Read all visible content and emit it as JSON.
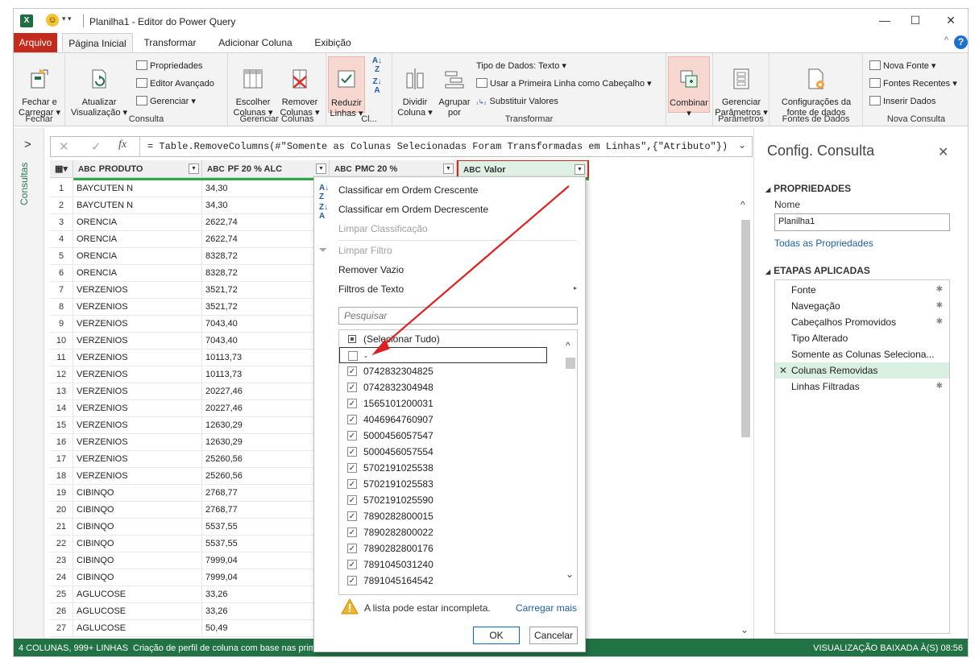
{
  "window": {
    "title": "Planilha1 - Editor do Power Query",
    "app_icon": "X",
    "quick_access": "▾ ▾"
  },
  "tabs": [
    "Arquivo",
    "Página Inicial",
    "Transformar",
    "Adicionar Coluna",
    "Exibição"
  ],
  "ribbon": {
    "fechar": {
      "btn": "Fechar e\nCarregar ▾",
      "group": "Fechar"
    },
    "consulta": {
      "atualizar": "Atualizar\nVisualização ▾",
      "propriedades": "Propriedades",
      "editor_avancado": "Editor Avançado",
      "gerenciar": "Gerenciar ▾",
      "group": "Consulta"
    },
    "colunas": {
      "escolher": "Escolher\nColunas ▾",
      "remover": "Remover\nColunas ▾",
      "group": "Gerenciar Colunas"
    },
    "reduzir": {
      "btn": "Reduzir\nLinhas ▾",
      "group": "Cl..."
    },
    "transformar": {
      "dividir": "Dividir\nColuna ▾",
      "agrupar": "Agrupar\npor",
      "tipo": "Tipo de Dados: Texto ▾",
      "primeira_linha": "Usar a Primeira Linha como Cabeçalho ▾",
      "substituir": "Substituir Valores",
      "group": "Transformar"
    },
    "combinar": {
      "btn": "Combinar\n▾"
    },
    "parametros": {
      "btn": "Gerenciar\nParâmetros ▾",
      "group": "Parâmetros"
    },
    "fontes": {
      "btn": "Configurações da\nfonte de dados",
      "group": "Fontes de Dados"
    },
    "nova": {
      "nova_fonte": "Nova Fonte ▾",
      "recentes": "Fontes Recentes ▾",
      "inserir": "Inserir Dados",
      "group": "Nova Consulta"
    }
  },
  "left_nav": {
    "label": "Consultas"
  },
  "formula": "= Table.RemoveColumns(#\"Somente as Colunas Selecionadas Foram Transformadas em Linhas\",{\"Atributo\"})",
  "columns": [
    {
      "type": "ABC",
      "name": "PRODUTO"
    },
    {
      "type": "ABC",
      "name": "PF 20 % ALC"
    },
    {
      "type": "ABC",
      "name": "PMC 20 %"
    },
    {
      "type": "ABC",
      "name": "Valor"
    }
  ],
  "rows": [
    [
      "1",
      "BAYCUTEN N",
      "34,30"
    ],
    [
      "2",
      "BAYCUTEN N",
      "34,30"
    ],
    [
      "3",
      "ORENCIA",
      "2622,74"
    ],
    [
      "4",
      "ORENCIA",
      "2622,74"
    ],
    [
      "5",
      "ORENCIA",
      "8328,72"
    ],
    [
      "6",
      "ORENCIA",
      "8328,72"
    ],
    [
      "7",
      "VERZENIOS",
      "3521,72"
    ],
    [
      "8",
      "VERZENIOS",
      "3521,72"
    ],
    [
      "9",
      "VERZENIOS",
      "7043,40"
    ],
    [
      "10",
      "VERZENIOS",
      "7043,40"
    ],
    [
      "11",
      "VERZENIOS",
      "10113,73"
    ],
    [
      "12",
      "VERZENIOS",
      "10113,73"
    ],
    [
      "13",
      "VERZENIOS",
      "20227,46"
    ],
    [
      "14",
      "VERZENIOS",
      "20227,46"
    ],
    [
      "15",
      "VERZENIOS",
      "12630,29"
    ],
    [
      "16",
      "VERZENIOS",
      "12630,29"
    ],
    [
      "17",
      "VERZENIOS",
      "25260,56"
    ],
    [
      "18",
      "VERZENIOS",
      "25260,56"
    ],
    [
      "19",
      "CIBINQO",
      "2768,77"
    ],
    [
      "20",
      "CIBINQO",
      "2768,77"
    ],
    [
      "21",
      "CIBINQO",
      "5537,55"
    ],
    [
      "22",
      "CIBINQO",
      "5537,55"
    ],
    [
      "23",
      "CIBINQO",
      "7999,04"
    ],
    [
      "24",
      "CIBINQO",
      "7999,04"
    ],
    [
      "25",
      "AGLUCOSE",
      "33,26"
    ],
    [
      "26",
      "AGLUCOSE",
      "33,26"
    ],
    [
      "27",
      "AGLUCOSE",
      "50,49"
    ]
  ],
  "popup": {
    "sort_asc": "Classificar em Ordem Crescente",
    "sort_desc": "Classificar em Ordem Decrescente",
    "clear_sort": "Limpar Classificação",
    "clear_filter": "Limpar Filtro",
    "remove_empty": "Remover Vazio",
    "text_filters": "Filtros de Texto",
    "search_placeholder": "Pesquisar",
    "select_all": "(Selecionar Tudo)",
    "items": [
      {
        "label": "-",
        "checked": false
      },
      {
        "label": "0742832304825",
        "checked": true
      },
      {
        "label": "0742832304948",
        "checked": true
      },
      {
        "label": "1565101200031",
        "checked": true
      },
      {
        "label": "4046964760907",
        "checked": true
      },
      {
        "label": "5000456057547",
        "checked": true
      },
      {
        "label": "5000456057554",
        "checked": true
      },
      {
        "label": "5702191025538",
        "checked": true
      },
      {
        "label": "5702191025583",
        "checked": true
      },
      {
        "label": "5702191025590",
        "checked": true
      },
      {
        "label": "7890282800015",
        "checked": true
      },
      {
        "label": "7890282800022",
        "checked": true
      },
      {
        "label": "7890282800176",
        "checked": true
      },
      {
        "label": "7891045031240",
        "checked": true
      },
      {
        "label": "7891045164542",
        "checked": true
      }
    ],
    "warning": "A lista pode estar incompleta.",
    "load_more": "Carregar mais",
    "ok": "OK",
    "cancel": "Cancelar"
  },
  "right_pane": {
    "title": "Config. Consulta",
    "properties": "PROPRIEDADES",
    "name_label": "Nome",
    "name_value": "Planilha1",
    "all_props": "Todas as Propriedades",
    "applied_steps": "ETAPAS APLICADAS",
    "steps": [
      {
        "label": "Fonte",
        "gear": true
      },
      {
        "label": "Navegação",
        "gear": true
      },
      {
        "label": "Cabeçalhos Promovidos",
        "gear": true
      },
      {
        "label": "Tipo Alterado",
        "gear": false
      },
      {
        "label": "Somente as Colunas Seleciona...",
        "gear": false
      },
      {
        "label": "Colunas Removidas",
        "gear": false,
        "selected": true
      },
      {
        "label": "Linhas Filtradas",
        "gear": true
      }
    ]
  },
  "status": {
    "left": "4 COLUNAS, 999+ LINHAS",
    "profile": "Criação de perfil de coluna com base nas primeiras 1000 linhas",
    "right": "VISUALIZAÇÃO BAIXADA À(S) 08:56"
  },
  "colors": {
    "accent": "#217346",
    "file_tab": "#c42b1c",
    "highlight": "#e02020"
  }
}
